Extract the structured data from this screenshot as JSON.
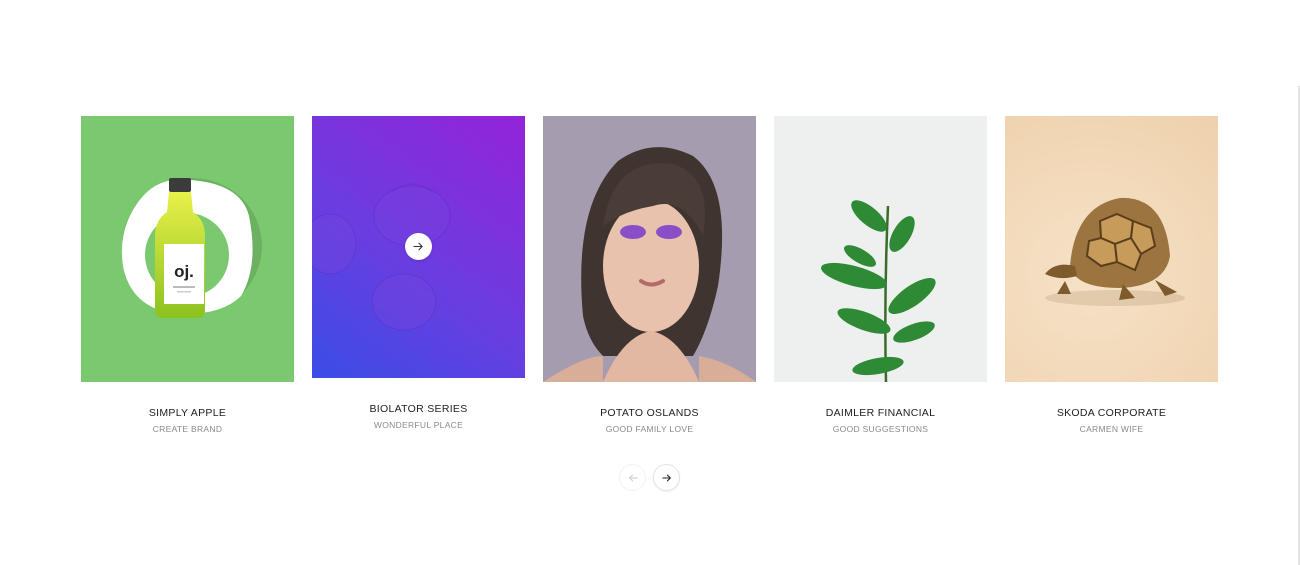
{
  "colors": {
    "card1_bg": "#7bc96f",
    "card2_gradient_from": "#9423d9",
    "card2_gradient_to": "#3a4de6",
    "card3_bg": "#a59cb0",
    "card4_bg": "#eef0ef",
    "card5_bg": "#f1d6b4"
  },
  "portfolio": {
    "items": [
      {
        "title": "SIMPLY APPLE",
        "subtitle": "CREATE BRAND",
        "bottle_label": "oj."
      },
      {
        "title": "BIOLATOR SERIES",
        "subtitle": "WONDERFUL PLACE"
      },
      {
        "title": "POTATO OSLANDS",
        "subtitle": "GOOD FAMILY LOVE"
      },
      {
        "title": "DAIMLER FINANCIAL",
        "subtitle": "GOOD SUGGESTIONS"
      },
      {
        "title": "SKODA CORPORATE",
        "subtitle": "CARMEN WIFE"
      }
    ]
  },
  "icons": {
    "view_project": "arrow-right-icon",
    "prev": "arrow-left-icon",
    "next": "arrow-right-icon"
  }
}
